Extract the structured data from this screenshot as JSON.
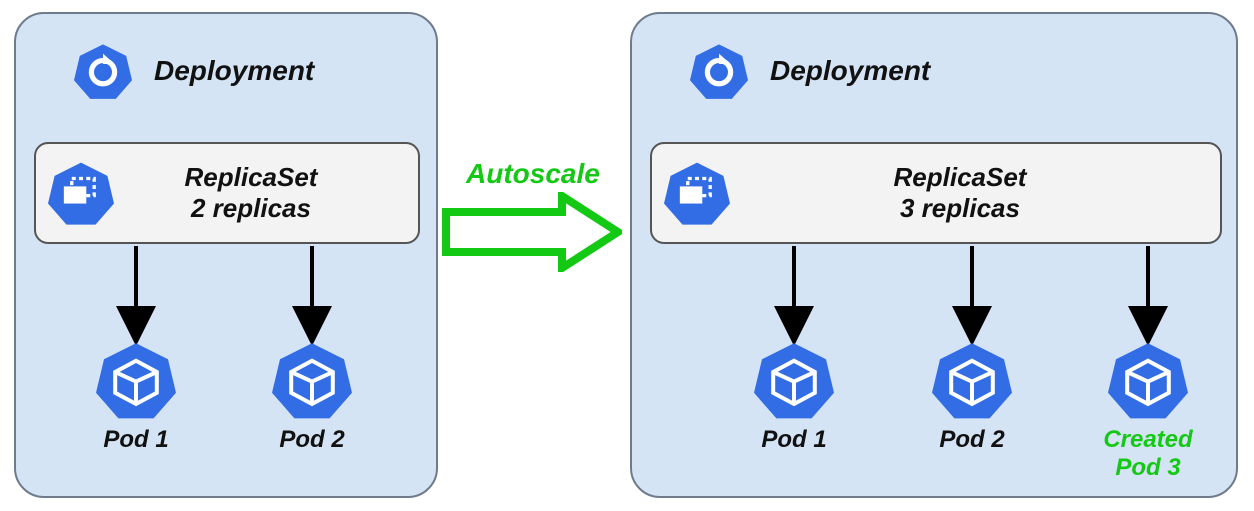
{
  "left": {
    "title": "Deployment",
    "replicaset": {
      "title": "ReplicaSet",
      "subtitle": "2 replicas"
    },
    "pods": [
      {
        "label": "Pod 1",
        "created": false
      },
      {
        "label": "Pod 2",
        "created": false
      }
    ]
  },
  "right": {
    "title": "Deployment",
    "replicaset": {
      "title": "ReplicaSet",
      "subtitle": "3 replicas"
    },
    "pods": [
      {
        "label": "Pod 1",
        "created": false
      },
      {
        "label": "Pod 2",
        "created": false
      },
      {
        "label": "Pod 3",
        "created": true,
        "prefix": "Created"
      }
    ]
  },
  "action": {
    "label": "Autoscale"
  },
  "colors": {
    "k8s_blue": "#326de6",
    "accent_green": "#14c914"
  }
}
